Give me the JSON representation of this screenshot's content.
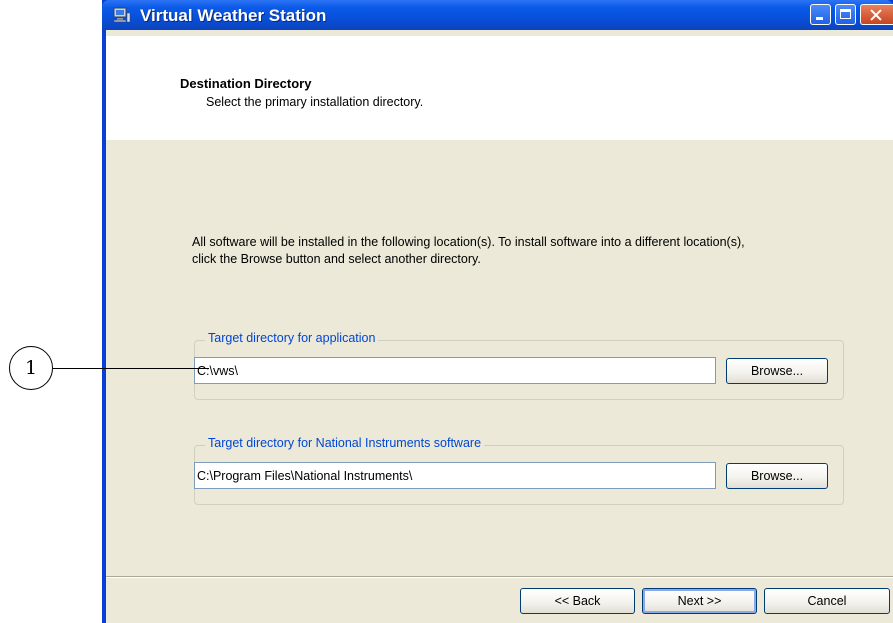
{
  "window": {
    "title": "Virtual Weather Station"
  },
  "header": {
    "title": "Destination Directory",
    "subtitle": "Select the primary installation directory."
  },
  "description": "All software will be installed in the following location(s). To install software into a different location(s), click the Browse button and select another directory.",
  "groups": [
    {
      "legend": "Target directory for application",
      "path": "C:\\vws\\",
      "browse_label": "Browse..."
    },
    {
      "legend": "Target directory for National Instruments software",
      "path": "C:\\Program Files\\National Instruments\\",
      "browse_label": "Browse..."
    }
  ],
  "footer": {
    "back_label": "<< Back",
    "next_label": "Next >>",
    "cancel_label": "Cancel"
  },
  "callout": {
    "label": "1"
  },
  "colors": {
    "titlebar": "#0851dc",
    "dialog_face": "#ece9d8",
    "group_legend": "#0046d5",
    "close_button": "#c74422"
  }
}
